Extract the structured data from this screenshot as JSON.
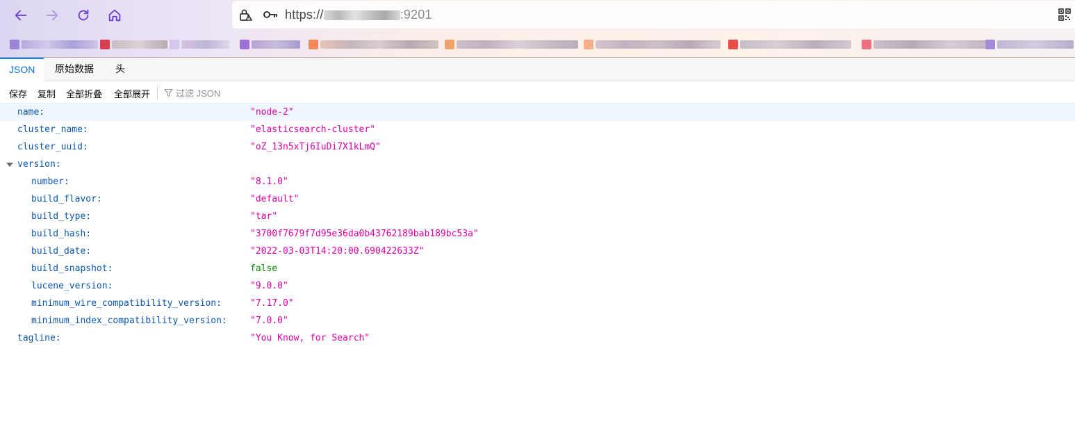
{
  "browser": {
    "url_scheme": "https://",
    "url_port": ":9201",
    "colors": {
      "nav_icon": "#6b3fd1",
      "accent": "#0a84ff"
    }
  },
  "viewer": {
    "tabs": [
      {
        "label": "JSON",
        "active": true
      },
      {
        "label": "原始数据",
        "active": false
      },
      {
        "label": "头",
        "active": false
      }
    ],
    "toolbar": {
      "save": "保存",
      "copy": "复制",
      "collapse_all": "全部折叠",
      "expand_all": "全部展开",
      "filter_placeholder": "过滤 JSON"
    },
    "rows": [
      {
        "key": "name:",
        "value": "\"node-2\"",
        "type": "string",
        "depth": 0
      },
      {
        "key": "cluster_name:",
        "value": "\"elasticsearch-cluster\"",
        "type": "string",
        "depth": 0
      },
      {
        "key": "cluster_uuid:",
        "value": "\"oZ_13n5xTj6IuDi7X1kLmQ\"",
        "type": "string",
        "depth": 0
      },
      {
        "key": "version:",
        "value": "",
        "type": "object",
        "depth": 0
      },
      {
        "key": "number:",
        "value": "\"8.1.0\"",
        "type": "string",
        "depth": 1
      },
      {
        "key": "build_flavor:",
        "value": "\"default\"",
        "type": "string",
        "depth": 1
      },
      {
        "key": "build_type:",
        "value": "\"tar\"",
        "type": "string",
        "depth": 1
      },
      {
        "key": "build_hash:",
        "value": "\"3700f7679f7d95e36da0b43762189bab189bc53a\"",
        "type": "string",
        "depth": 1
      },
      {
        "key": "build_date:",
        "value": "\"2022-03-03T14:20:00.690422633Z\"",
        "type": "string",
        "depth": 1
      },
      {
        "key": "build_snapshot:",
        "value": "false",
        "type": "boolean",
        "depth": 1
      },
      {
        "key": "lucene_version:",
        "value": "\"9.0.0\"",
        "type": "string",
        "depth": 1
      },
      {
        "key": "minimum_wire_compatibility_version:",
        "value": "\"7.17.0\"",
        "type": "string",
        "depth": 1
      },
      {
        "key": "minimum_index_compatibility_version:",
        "value": "\"7.0.0\"",
        "type": "string",
        "depth": 1
      },
      {
        "key": "tagline:",
        "value": "\"You Know, for Search\"",
        "type": "string",
        "depth": 0
      }
    ]
  }
}
